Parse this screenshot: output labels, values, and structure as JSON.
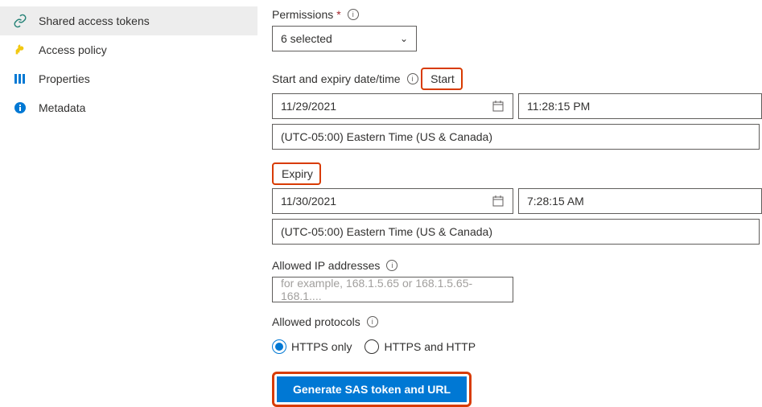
{
  "sidebar": {
    "items": [
      {
        "label": "Shared access tokens"
      },
      {
        "label": "Access policy"
      },
      {
        "label": "Properties"
      },
      {
        "label": "Metadata"
      }
    ]
  },
  "main": {
    "permissions_label": "Permissions",
    "permissions_value": "6 selected",
    "dates_label": "Start and expiry date/time",
    "start_label": "Start",
    "start_date": "11/29/2021",
    "start_time": "11:28:15 PM",
    "start_tz": "(UTC-05:00) Eastern Time (US & Canada)",
    "expiry_label": "Expiry",
    "expiry_date": "11/30/2021",
    "expiry_time": "7:28:15 AM",
    "expiry_tz": "(UTC-05:00) Eastern Time (US & Canada)",
    "ip_label": "Allowed IP addresses",
    "ip_placeholder": "for example, 168.1.5.65 or 168.1.5.65-168.1....",
    "protocols_label": "Allowed protocols",
    "protocols": {
      "https_only": "HTTPS only",
      "https_http": "HTTPS and HTTP"
    },
    "generate_label": "Generate SAS token and URL"
  }
}
